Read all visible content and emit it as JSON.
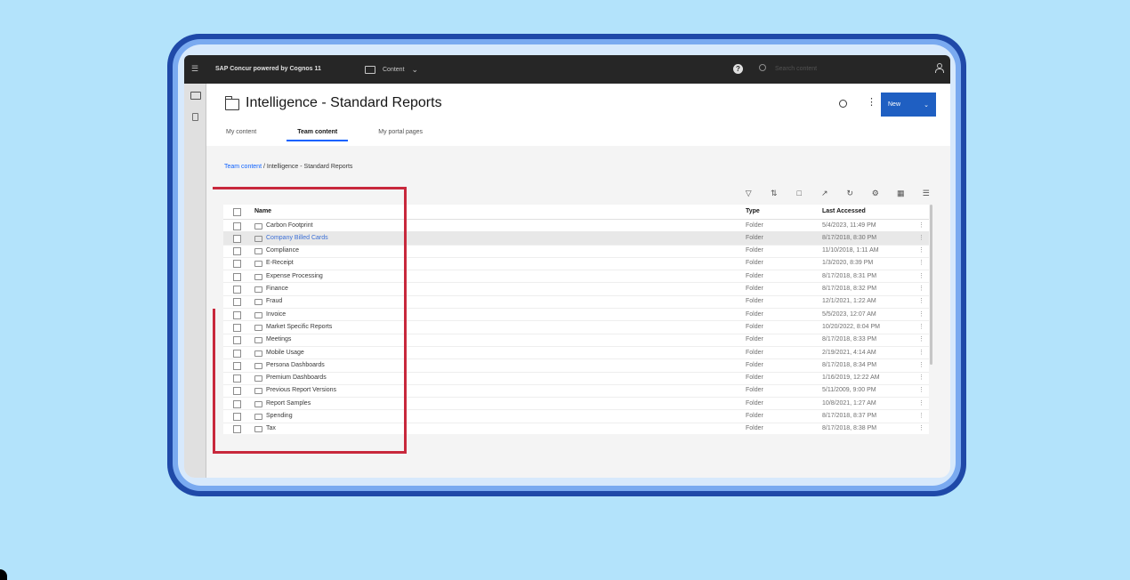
{
  "topbar": {
    "brand": "SAP Concur powered by Cognos 11",
    "context_label": "Content",
    "search_placeholder": "Search content",
    "icons": [
      "hamburger-icon",
      "folder-icon",
      "chevron-down-icon",
      "help-icon",
      "search-icon",
      "user-icon"
    ]
  },
  "header": {
    "title": "Intelligence - Standard Reports",
    "new_button": "New",
    "tabs": [
      {
        "label": "My content",
        "active": false
      },
      {
        "label": "Team content",
        "active": true
      },
      {
        "label": "My portal pages",
        "active": false
      }
    ]
  },
  "breadcrumb": {
    "root": "Team content",
    "separator": "/",
    "current": "Intelligence - Standard Reports"
  },
  "toolbar": {
    "icons": [
      "filter-icon",
      "sort-icon",
      "new-folder-icon",
      "upload-icon",
      "refresh-icon",
      "settings-icon",
      "grid-view-icon",
      "list-view-icon"
    ]
  },
  "table": {
    "columns": {
      "name": "Name",
      "type": "Type",
      "last_accessed": "Last Accessed"
    },
    "rows": [
      {
        "name": "Carbon Footprint",
        "type": "Folder",
        "last_accessed": "5/4/2023, 11:49 PM"
      },
      {
        "name": "Company Billed Cards",
        "type": "Folder",
        "last_accessed": "8/17/2018, 8:30 PM",
        "selected": true
      },
      {
        "name": "Compliance",
        "type": "Folder",
        "last_accessed": "11/10/2018, 1:11 AM"
      },
      {
        "name": "E-Receipt",
        "type": "Folder",
        "last_accessed": "1/3/2020, 8:39 PM"
      },
      {
        "name": "Expense Processing",
        "type": "Folder",
        "last_accessed": "8/17/2018, 8:31 PM"
      },
      {
        "name": "Finance",
        "type": "Folder",
        "last_accessed": "8/17/2018, 8:32 PM"
      },
      {
        "name": "Fraud",
        "type": "Folder",
        "last_accessed": "12/1/2021, 1:22 AM"
      },
      {
        "name": "Invoice",
        "type": "Folder",
        "last_accessed": "5/5/2023, 12:07 AM"
      },
      {
        "name": "Market Specific Reports",
        "type": "Folder",
        "last_accessed": "10/20/2022, 8:04 PM"
      },
      {
        "name": "Meetings",
        "type": "Folder",
        "last_accessed": "8/17/2018, 8:33 PM"
      },
      {
        "name": "Mobile Usage",
        "type": "Folder",
        "last_accessed": "2/19/2021, 4:14 AM"
      },
      {
        "name": "Persona Dashboards",
        "type": "Folder",
        "last_accessed": "8/17/2018, 8:34 PM"
      },
      {
        "name": "Premium Dashboards",
        "type": "Folder",
        "last_accessed": "1/16/2019, 12:22 AM"
      },
      {
        "name": "Previous Report Versions",
        "type": "Folder",
        "last_accessed": "5/11/2009, 9:00 PM"
      },
      {
        "name": "Report Samples",
        "type": "Folder",
        "last_accessed": "10/8/2021, 1:27 AM"
      },
      {
        "name": "Spending",
        "type": "Folder",
        "last_accessed": "8/17/2018, 8:37 PM"
      },
      {
        "name": "Tax",
        "type": "Folder",
        "last_accessed": "8/17/2018, 8:38 PM"
      }
    ]
  },
  "colors": {
    "background": "#b3e3fb",
    "device_frame": "#1f49a8",
    "topbar": "#262626",
    "primary_button": "#1f5fc2",
    "highlight": "#c8283c",
    "link": "#0f62fe"
  }
}
